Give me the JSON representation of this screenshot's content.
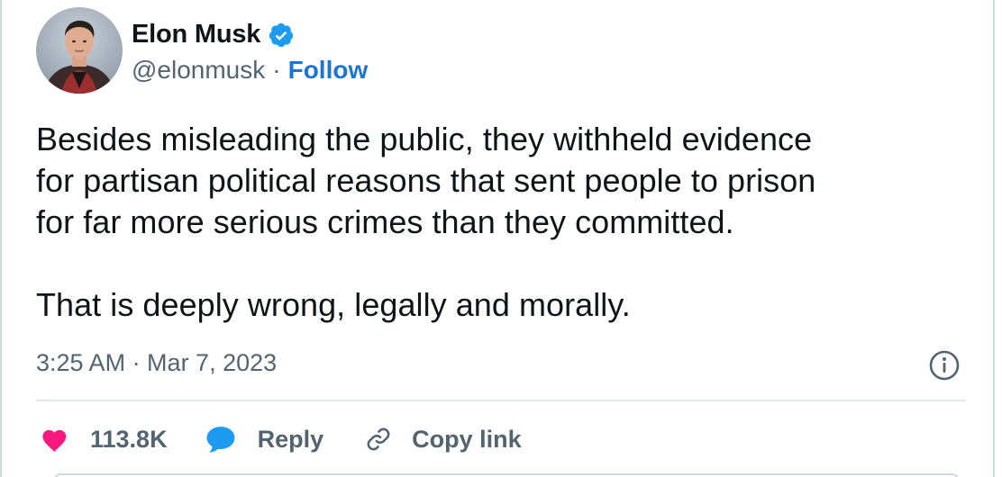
{
  "author": {
    "name": "Elon Musk",
    "handle": "@elonmusk",
    "separator": "·",
    "follow_label": "Follow",
    "verified": true,
    "verified_color": "#1d9bf0"
  },
  "tweet": {
    "text": "Besides misleading the public, they withheld evidence\nfor partisan political reasons that sent people to prison\nfor far more serious crimes than they committed.\n\nThat is deeply wrong, legally and morally.",
    "timestamp": "3:25 AM · Mar 7, 2023"
  },
  "actions": {
    "like_count": "113.8K",
    "like_color": "#f91880",
    "reply_label": "Reply",
    "reply_color": "#1d9bf0",
    "copy_link_label": "Copy link"
  },
  "icons": {
    "verified": "verified-badge-icon",
    "info": "info-icon",
    "like": "heart-icon",
    "reply": "speech-bubble-icon",
    "copy": "link-icon"
  }
}
